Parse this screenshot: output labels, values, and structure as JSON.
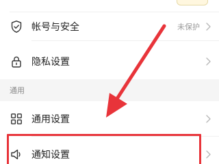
{
  "settings": {
    "account_security": {
      "label": "帐号与安全",
      "status": "未保护",
      "icon": "shield-check-icon"
    },
    "privacy": {
      "label": "隐私设置",
      "icon": "lock-icon"
    },
    "section_general": {
      "label": "通用"
    },
    "general": {
      "label": "通用设置",
      "icon": "grid-icon"
    },
    "notifications": {
      "label": "通知设置",
      "icon": "speaker-icon"
    }
  },
  "annotation": {
    "color": "#e8343a",
    "arrow_icon": "red-arrow-icon",
    "highlight_target": "通知设置"
  }
}
